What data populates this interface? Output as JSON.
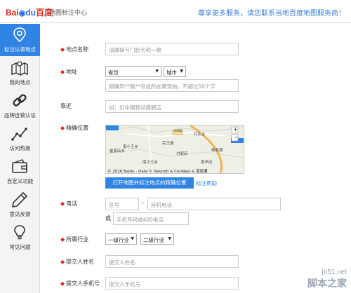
{
  "header": {
    "logo_bai": "Bai",
    "logo_du": "du",
    "logo_cn": "百度",
    "subtitle": "地图标注中心",
    "message": "尊享更多服务，请您联系当地百度地图服务商！"
  },
  "sidebar": {
    "items": [
      {
        "label": "标注认领地点",
        "icon": "location-pin-icon",
        "active": true
      },
      {
        "label": "我的地点",
        "icon": "map-icon",
        "active": false
      },
      {
        "label": "品牌连锁认证",
        "icon": "chain-link-icon",
        "active": false
      },
      {
        "label": "访问热度",
        "icon": "line-chart-icon",
        "active": false
      },
      {
        "label": "自定义功能",
        "icon": "wallet-icon",
        "active": false
      },
      {
        "label": "意见反馈",
        "icon": "pencil-icon",
        "active": false
      },
      {
        "label": "常见问题",
        "icon": "lightbulb-icon",
        "active": false
      }
    ]
  },
  "form": {
    "name": {
      "label": "地点名称",
      "placeholder": "请确保与门脸名称一致"
    },
    "address": {
      "label": "地址",
      "province": "省份",
      "city": "城市",
      "detail_placeholder": "精确到**路**号或所在建筑物，不超过50个字"
    },
    "nearby": {
      "label": "靠近",
      "placeholder": "如：近中国移动旗舰店"
    },
    "location": {
      "label": "精确位置",
      "map_places": [
        "南小王乡",
        "付店乡",
        "南辛店",
        "崔家店乡",
        "后王镇",
        "柳各镇",
        "南小王乡",
        "付家店"
      ],
      "map_road_badge": "S302",
      "copyright": "© 2016 Baidu - Data © NavInfo & CenNavi & 道道通",
      "open_map_button": "打开地图并标注地点的精确位置",
      "help_link": "标注帮助"
    },
    "phone": {
      "label": "电话",
      "area_placeholder": "区号",
      "dash": "-",
      "phone_placeholder": "座机电话",
      "or": "或",
      "mobile_placeholder": "手机号码或400电话"
    },
    "industry": {
      "label": "所属行业",
      "level1": "一级行业",
      "level2": "二级行业"
    },
    "submitter_name": {
      "label": "提交人姓名",
      "placeholder": "提交人姓名"
    },
    "submitter_phone": {
      "label": "提交人手机号",
      "placeholder": "提交人手机号"
    }
  },
  "watermark": {
    "url": "jb51.net",
    "name": "脚本之家"
  },
  "colors": {
    "accent": "#2f84e4",
    "required": "#e1251b",
    "brand_red": "#e1251b",
    "brand_blue": "#2b6de5"
  }
}
